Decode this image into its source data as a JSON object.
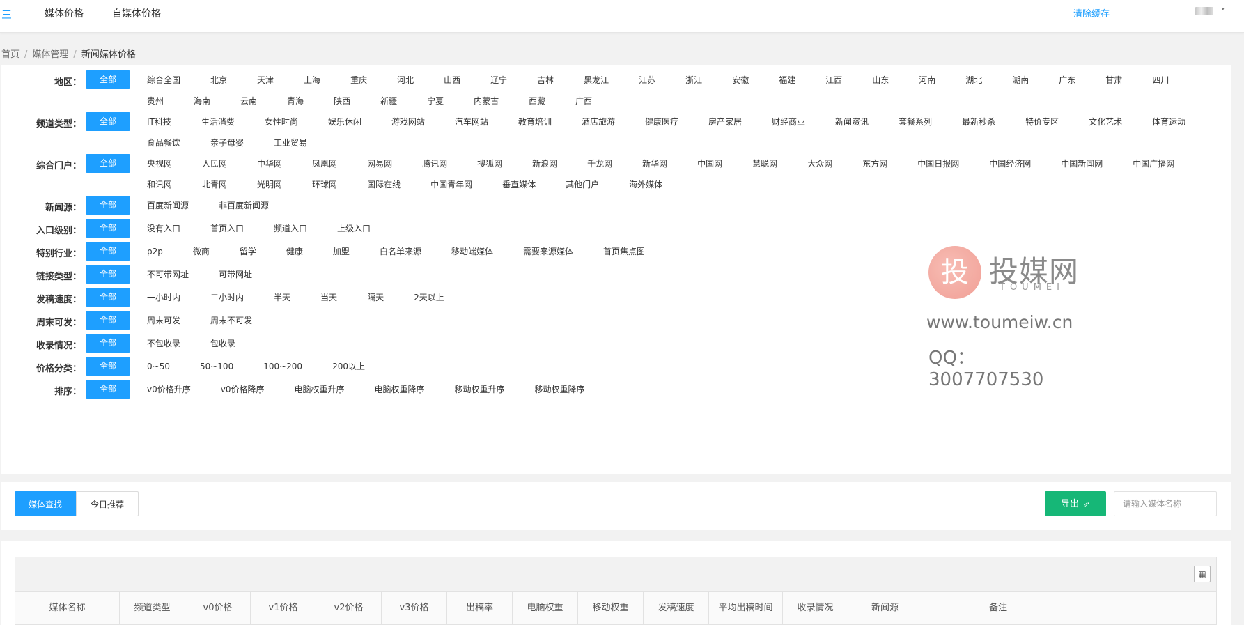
{
  "topbar": {
    "menu_icon": "三",
    "nav": [
      "媒体价格",
      "自媒体价格"
    ],
    "clear_cache": "清除缓存"
  },
  "breadcrumb": [
    "首页",
    "媒体管理",
    "新闻媒体价格"
  ],
  "filters": [
    {
      "label": "地区：",
      "all": "全部",
      "options": [
        "综合全国",
        "北京",
        "天津",
        "上海",
        "重庆",
        "河北",
        "山西",
        "辽宁",
        "吉林",
        "黑龙江",
        "江苏",
        "浙江",
        "安徽",
        "福建",
        "江西",
        "山东",
        "河南",
        "湖北",
        "湖南",
        "广东",
        "甘肃",
        "四川",
        "贵州",
        "海南",
        "云南",
        "青海",
        "陕西",
        "新疆",
        "宁夏",
        "内蒙古",
        "西藏",
        "广西"
      ]
    },
    {
      "label": "频道类型：",
      "all": "全部",
      "options": [
        "IT科技",
        "生活消费",
        "女性时尚",
        "娱乐休闲",
        "游戏网站",
        "汽车网站",
        "教育培训",
        "酒店旅游",
        "健康医疗",
        "房产家居",
        "财经商业",
        "新闻资讯",
        "套餐系列",
        "最新秒杀",
        "特价专区",
        "文化艺术",
        "体育运动",
        "食品餐饮",
        "亲子母婴",
        "工业贸易"
      ]
    },
    {
      "label": "综合门户：",
      "all": "全部",
      "options": [
        "央视网",
        "人民网",
        "中华网",
        "凤凰网",
        "网易网",
        "腾讯网",
        "搜狐网",
        "新浪网",
        "千龙网",
        "新华网",
        "中国网",
        "慧聪网",
        "大众网",
        "东方网",
        "中国日报网",
        "中国经济网",
        "中国新闻网",
        "中国广播网",
        "和讯网",
        "北青网",
        "光明网",
        "环球网",
        "国际在线",
        "中国青年网",
        "垂直媒体",
        "其他门户",
        "海外媒体"
      ]
    },
    {
      "label": "新闻源：",
      "all": "全部",
      "options": [
        "百度新闻源",
        "非百度新闻源"
      ]
    },
    {
      "label": "入口级别：",
      "all": "全部",
      "options": [
        "没有入口",
        "首页入口",
        "频道入口",
        "上级入口"
      ]
    },
    {
      "label": "特别行业：",
      "all": "全部",
      "options": [
        "p2p",
        "微商",
        "留学",
        "健康",
        "加盟",
        "白名单来源",
        "移动端媒体",
        "需要来源媒体",
        "首页焦点图"
      ]
    },
    {
      "label": "链接类型：",
      "all": "全部",
      "options": [
        "不可带网址",
        "可带网址"
      ]
    },
    {
      "label": "发稿速度：",
      "all": "全部",
      "options": [
        "一小时内",
        "二小时内",
        "半天",
        "当天",
        "隔天",
        "2天以上"
      ]
    },
    {
      "label": "周末可发：",
      "all": "全部",
      "options": [
        "周末可发",
        "周末不可发"
      ]
    },
    {
      "label": "收录情况：",
      "all": "全部",
      "options": [
        "不包收录",
        "包收录"
      ]
    },
    {
      "label": "价格分类：",
      "all": "全部",
      "options": [
        "0~50",
        "50~100",
        "100~200",
        "200以上"
      ]
    },
    {
      "label": "排序：",
      "all": "全部",
      "options": [
        "v0价格升序",
        "v0价格降序",
        "电脑权重升序",
        "电脑权重降序",
        "移动权重升序",
        "移动权重降序"
      ]
    }
  ],
  "watermark": {
    "glyph": "投",
    "name": "投媒网",
    "latin": "TOUMEI",
    "url": "www.toumeiw.cn",
    "qq": "QQ：3007707530"
  },
  "tabs": [
    "媒体查找",
    "今日推荐"
  ],
  "export_label": "导出",
  "search_placeholder": "请输入媒体名称",
  "table": {
    "columns": [
      "媒体名称",
      "频道类型",
      "v0价格",
      "v1价格",
      "v2价格",
      "v3价格",
      "出稿率",
      "电脑权重",
      "移动权重",
      "发稿速度",
      "平均出稿时间",
      "收录情况",
      "新闻源",
      "备注"
    ]
  }
}
